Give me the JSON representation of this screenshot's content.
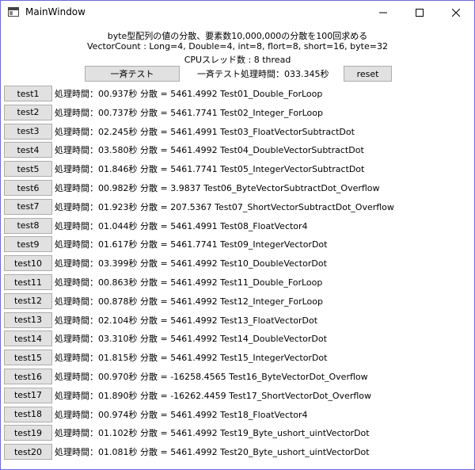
{
  "window": {
    "title": "MainWindow"
  },
  "header": {
    "line1": "byte型配列の値の分散、要素数10,000,000の分散を100回求める",
    "line2": "VectorCount : Long=4, Double=4, int=8, flort=8, short=16, byte=32",
    "line3": "CPUスレッド数 : 8 thread"
  },
  "controls": {
    "batch_label": "一斉テスト",
    "batch_time": "一斉テスト処理時間：033.345秒",
    "reset_label": "reset"
  },
  "tests": [
    {
      "label": "test1",
      "result": "処理時間：00.937秒  分散 = 5461.4992  Test01_Double_ForLoop"
    },
    {
      "label": "test2",
      "result": "処理時間：00.737秒  分散 = 5461.7741  Test02_Integer_ForLoop"
    },
    {
      "label": "test3",
      "result": "処理時間：02.245秒  分散 = 5461.4991  Test03_FloatVectorSubtractDot"
    },
    {
      "label": "test4",
      "result": "処理時間：03.580秒  分散 = 5461.4992  Test04_DoubleVectorSubtractDot"
    },
    {
      "label": "test5",
      "result": "処理時間：01.846秒  分散 = 5461.7741  Test05_IntegerVectorSubtractDot"
    },
    {
      "label": "test6",
      "result": "処理時間：00.982秒  分散 = 3.9837  Test06_ByteVectorSubtractDot_Overflow"
    },
    {
      "label": "test7",
      "result": "処理時間：01.923秒  分散 = 207.5367  Test07_ShortVectorSubtractDot_Overflow"
    },
    {
      "label": "test8",
      "result": "処理時間：01.044秒  分散 = 5461.4991  Test08_FloatVector4"
    },
    {
      "label": "test9",
      "result": "処理時間：01.617秒  分散 = 5461.7741  Test09_IntegerVectorDot"
    },
    {
      "label": "test10",
      "result": "処理時間：03.399秒  分散 = 5461.4992  Test10_DoubleVectorDot"
    },
    {
      "label": "test11",
      "result": "処理時間：00.863秒  分散 = 5461.4992  Test11_Double_ForLoop"
    },
    {
      "label": "test12",
      "result": "処理時間：00.878秒  分散 = 5461.4992  Test12_Integer_ForLoop"
    },
    {
      "label": "test13",
      "result": "処理時間：02.104秒  分散 = 5461.4992  Test13_FloatVectorDot"
    },
    {
      "label": "test14",
      "result": "処理時間：03.310秒  分散 = 5461.4992  Test14_DoubleVectorDot"
    },
    {
      "label": "test15",
      "result": "処理時間：01.815秒  分散 = 5461.4992  Test15_IntegerVectorDot"
    },
    {
      "label": "test16",
      "result": "処理時間：00.970秒  分散 = -16258.4565  Test16_ByteVectorDot_Overflow"
    },
    {
      "label": "test17",
      "result": "処理時間：01.890秒  分散 = -16262.4459  Test17_ShortVectorDot_Overflow"
    },
    {
      "label": "test18",
      "result": "処理時間：00.974秒  分散 = 5461.4992  Test18_FloatVector4"
    },
    {
      "label": "test19",
      "result": "処理時間：01.102秒  分散 = 5461.4992  Test19_Byte_ushort_uintVectorDot"
    },
    {
      "label": "test20",
      "result": "処理時間：01.081秒  分散 = 5461.4992  Test20_Byte_ushort_uintVectorDot"
    }
  ]
}
